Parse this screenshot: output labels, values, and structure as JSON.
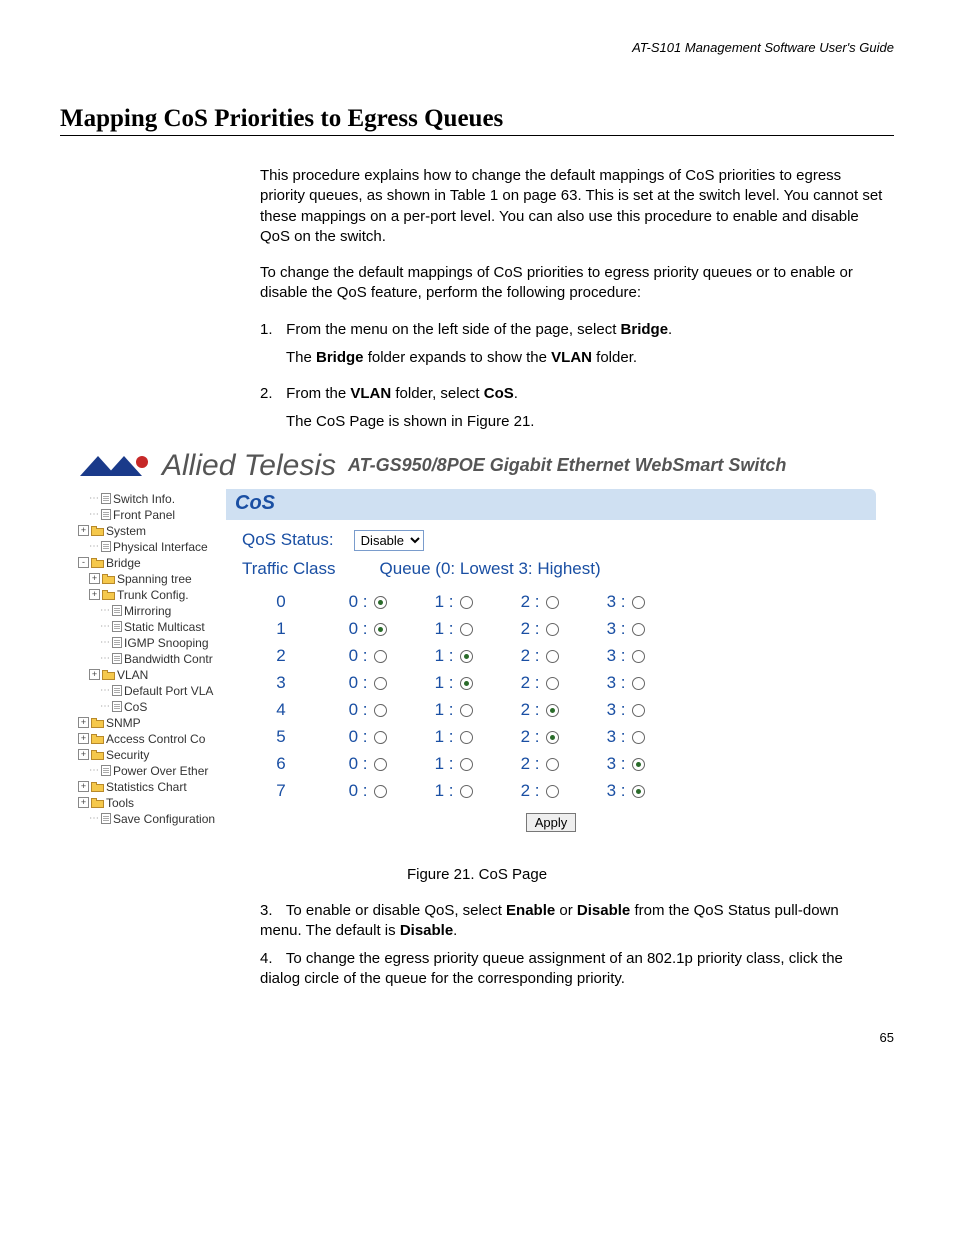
{
  "header": {
    "guide_title": "AT-S101 Management Software User's Guide"
  },
  "section": {
    "heading": "Mapping CoS Priorities to Egress Queues"
  },
  "intro": {
    "p1": "This procedure explains how to change the default mappings of CoS priorities to egress priority queues, as shown in Table 1 on page 63. This is set at the switch level. You cannot set these mappings on a per-port level. You can also use this procedure to enable and disable QoS on the switch.",
    "p2": "To change the default mappings of CoS priorities to egress priority queues or to enable or disable the QoS feature, perform the following procedure:"
  },
  "steps": {
    "s1_pre": "From the menu on the left side of the page, select ",
    "s1_bold": "Bridge",
    "s1_post": ".",
    "s1_sub_a": "The ",
    "s1_sub_b": "Bridge",
    "s1_sub_c": " folder expands to show the ",
    "s1_sub_d": "VLAN",
    "s1_sub_e": " folder.",
    "s2_pre": "From the ",
    "s2_b1": "VLAN",
    "s2_mid": " folder, select ",
    "s2_b2": "CoS",
    "s2_post": ".",
    "s2_sub": "The CoS Page is shown in Figure 21.",
    "s3_pre": "To enable or disable QoS, select ",
    "s3_b1": "Enable",
    "s3_mid1": " or ",
    "s3_b2": "Disable",
    "s3_mid2": " from the QoS Status pull-down menu. The default is ",
    "s3_b3": "Disable",
    "s3_post": ".",
    "s4": "To change the egress priority queue assignment of an 802.1p priority class, click the dialog circle of the queue for the corresponding priority."
  },
  "figure": {
    "brand": "Allied Telesis",
    "product": "AT-GS950/8POE Gigabit Ethernet WebSmart Switch",
    "panel_title": "CoS",
    "qos_label": "QoS Status:",
    "qos_selected": "Disable",
    "traffic_class_h": "Traffic Class",
    "queue_h": "Queue  (0: Lowest 3: Highest)",
    "apply": "Apply",
    "caption": "Figure 21. CoS Page",
    "tree": [
      {
        "lvl": 2,
        "exp": "",
        "icon": "page",
        "label": "Switch Info."
      },
      {
        "lvl": 2,
        "exp": "",
        "icon": "page",
        "label": "Front Panel"
      },
      {
        "lvl": 1,
        "exp": "+",
        "icon": "folder",
        "label": "System"
      },
      {
        "lvl": 2,
        "exp": "",
        "icon": "page",
        "label": "Physical Interface"
      },
      {
        "lvl": 1,
        "exp": "-",
        "icon": "folder-open",
        "label": "Bridge"
      },
      {
        "lvl": 2,
        "exp": "+",
        "icon": "folder",
        "label": "Spanning tree"
      },
      {
        "lvl": 2,
        "exp": "+",
        "icon": "folder",
        "label": "Trunk Config."
      },
      {
        "lvl": 3,
        "exp": "",
        "icon": "page",
        "label": "Mirroring"
      },
      {
        "lvl": 3,
        "exp": "",
        "icon": "page",
        "label": "Static Multicast"
      },
      {
        "lvl": 3,
        "exp": "",
        "icon": "page",
        "label": "IGMP Snooping"
      },
      {
        "lvl": 3,
        "exp": "",
        "icon": "page",
        "label": "Bandwidth Contr"
      },
      {
        "lvl": 2,
        "exp": "+",
        "icon": "folder",
        "label": "VLAN"
      },
      {
        "lvl": 3,
        "exp": "",
        "icon": "page",
        "label": "Default Port VLA"
      },
      {
        "lvl": 3,
        "exp": "",
        "icon": "page",
        "label": "CoS"
      },
      {
        "lvl": 1,
        "exp": "+",
        "icon": "folder",
        "label": "SNMP"
      },
      {
        "lvl": 1,
        "exp": "+",
        "icon": "folder",
        "label": "Access Control Co"
      },
      {
        "lvl": 1,
        "exp": "+",
        "icon": "folder",
        "label": "Security"
      },
      {
        "lvl": 2,
        "exp": "",
        "icon": "page",
        "label": "Power Over Ether"
      },
      {
        "lvl": 1,
        "exp": "+",
        "icon": "folder",
        "label": "Statistics Chart"
      },
      {
        "lvl": 1,
        "exp": "+",
        "icon": "folder",
        "label": "Tools"
      },
      {
        "lvl": 2,
        "exp": "",
        "icon": "page",
        "label": "Save Configuration"
      }
    ]
  },
  "chart_data": {
    "type": "table",
    "title": "CoS Traffic Class to Queue mapping",
    "columns": [
      "Traffic Class",
      "Queue 0",
      "Queue 1",
      "Queue 2",
      "Queue 3"
    ],
    "selected_queue_by_class": {
      "0": 0,
      "1": 0,
      "2": 1,
      "3": 1,
      "4": 2,
      "5": 2,
      "6": 3,
      "7": 3
    },
    "queue_labels": [
      "0 :",
      "1 :",
      "2 :",
      "3 :"
    ],
    "traffic_classes": [
      0,
      1,
      2,
      3,
      4,
      5,
      6,
      7
    ]
  },
  "page_number": "65"
}
